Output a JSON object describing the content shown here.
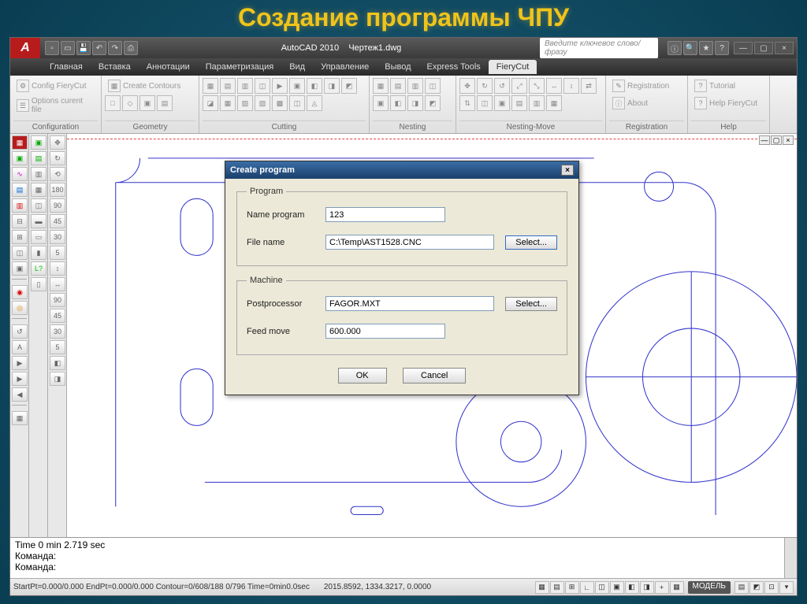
{
  "slide": {
    "title": "Создание программы ЧПУ"
  },
  "titlebar": {
    "app": "AutoCAD 2010",
    "file": "Чертеж1.dwg",
    "search_placeholder": "Введите ключевое слово/фразу"
  },
  "menubar": [
    "Главная",
    "Вставка",
    "Аннотации",
    "Параметризация",
    "Вид",
    "Управление",
    "Вывод",
    "Express Tools",
    "FieryCut"
  ],
  "ribbon": {
    "configuration": {
      "label": "Configuration",
      "items": [
        "Config FieryCut",
        "Options curent file"
      ]
    },
    "geometry": {
      "label": "Geometry",
      "items": [
        "Create Contours"
      ]
    },
    "cutting": {
      "label": "Cutting"
    },
    "nesting": {
      "label": "Nesting"
    },
    "nesting_move": {
      "label": "Nesting-Move"
    },
    "registration": {
      "label": "Registration",
      "items": [
        "Registration",
        "About"
      ]
    },
    "help": {
      "label": "Help",
      "items": [
        "Tutorial",
        "Help FieryCut"
      ]
    }
  },
  "dialog": {
    "title": "Create program",
    "program": {
      "legend": "Program",
      "name_label": "Name program",
      "name_value": "123",
      "file_label": "File name",
      "file_value": "C:\\Temp\\AST1528.CNC",
      "select": "Select..."
    },
    "machine": {
      "legend": "Machine",
      "post_label": "Postprocessor",
      "post_value": "FAGOR.MXT",
      "select": "Select...",
      "feed_label": "Feed move",
      "feed_value": "600.000"
    },
    "ok": "OK",
    "cancel": "Cancel"
  },
  "cmd": {
    "line1": "Time  0 min 2.719 sec",
    "line2": "Команда:",
    "line3": "Команда:"
  },
  "status": {
    "left": "StartPt=0.000/0.000 EndPt=0.000/0.000 Contour=0/608/188 0/796 Time=0min0.0sec",
    "coords": "2015.8592, 1334.3217, 0.0000",
    "model": "МОДЕЛЬ"
  }
}
